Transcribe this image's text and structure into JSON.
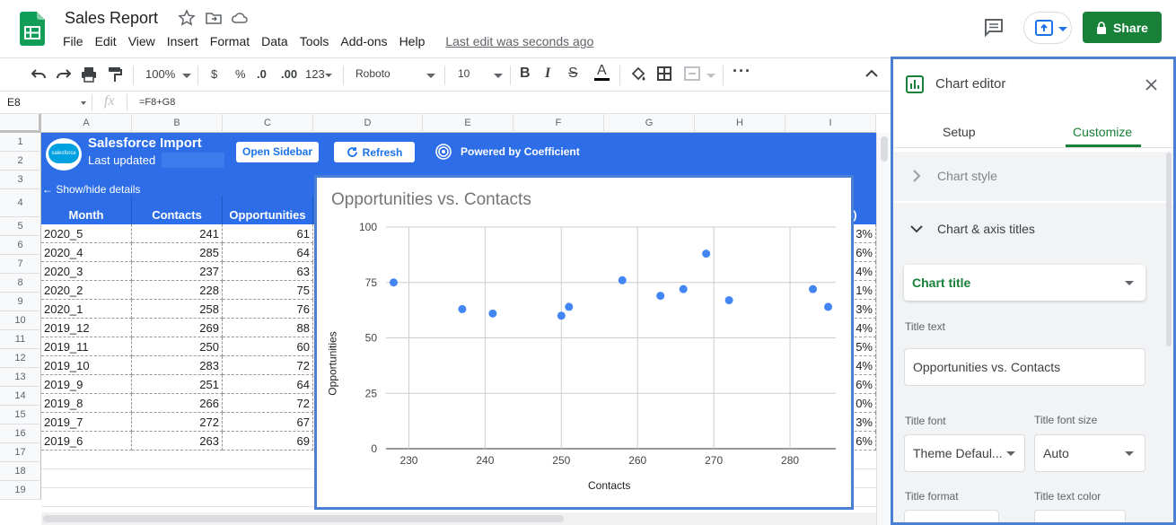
{
  "doc": {
    "title": "Sales Report",
    "menu": [
      "File",
      "Edit",
      "View",
      "Insert",
      "Format",
      "Data",
      "Tools",
      "Add-ons",
      "Help"
    ],
    "last_edit": "Last edit was seconds ago",
    "share_label": "Share"
  },
  "toolbar": {
    "zoom": "100%",
    "currency": "$",
    "percent": "%",
    "dec_less": ".0",
    "dec_more": ".00",
    "format_more": "123",
    "font": "Roboto",
    "font_size": "10"
  },
  "formula": {
    "cell_ref": "E8",
    "fx": "fx",
    "formula": "=F8+G8"
  },
  "columns": [
    "A",
    "B",
    "C",
    "D",
    "E",
    "F",
    "G",
    "H",
    "I"
  ],
  "rows": [
    "1",
    "2",
    "3",
    "4",
    "5",
    "6",
    "7",
    "8",
    "9",
    "10",
    "11",
    "12",
    "13",
    "14",
    "15",
    "16",
    "17",
    "18",
    "19"
  ],
  "banner": {
    "title": "Salesforce Import",
    "subtitle": "Last updated",
    "open_sidebar": "Open Sidebar",
    "refresh": "Refresh",
    "powered_by": "Powered by Coefficient",
    "show_hide": "← Show/hide details",
    "logo_text": "salesforce"
  },
  "table": {
    "headers": [
      "Month",
      "Contacts",
      "Opportunities"
    ],
    "right_header_fragment": "6)",
    "rows": [
      {
        "month": "2020_5",
        "contacts": "241",
        "opps": "61",
        "pct": "3%"
      },
      {
        "month": "2020_4",
        "contacts": "285",
        "opps": "64",
        "pct": "6%"
      },
      {
        "month": "2020_3",
        "contacts": "237",
        "opps": "63",
        "pct": "4%"
      },
      {
        "month": "2020_2",
        "contacts": "228",
        "opps": "75",
        "pct": "1%"
      },
      {
        "month": "2020_1",
        "contacts": "258",
        "opps": "76",
        "pct": "3%"
      },
      {
        "month": "2019_12",
        "contacts": "269",
        "opps": "88",
        "pct": "4%"
      },
      {
        "month": "2019_11",
        "contacts": "250",
        "opps": "60",
        "pct": "5%"
      },
      {
        "month": "2019_10",
        "contacts": "283",
        "opps": "72",
        "pct": "4%"
      },
      {
        "month": "2019_9",
        "contacts": "251",
        "opps": "64",
        "pct": "6%"
      },
      {
        "month": "2019_8",
        "contacts": "266",
        "opps": "72",
        "pct": "0%"
      },
      {
        "month": "2019_7",
        "contacts": "272",
        "opps": "67",
        "pct": "3%"
      },
      {
        "month": "2019_6",
        "contacts": "263",
        "opps": "69",
        "pct": "6%"
      }
    ]
  },
  "chart_data": {
    "type": "scatter",
    "title": "Opportunities vs. Contacts",
    "xlabel": "Contacts",
    "ylabel": "Opportunities",
    "xlim": [
      227,
      286
    ],
    "ylim": [
      0,
      100
    ],
    "xticks": [
      "230",
      "240",
      "250",
      "260",
      "270",
      "280"
    ],
    "yticks": [
      "0",
      "25",
      "50",
      "75",
      "100"
    ],
    "grid": true,
    "series": [
      {
        "x": [
          228,
          237,
          241,
          250,
          251,
          258,
          263,
          266,
          269,
          272,
          283,
          285
        ],
        "y": [
          75,
          63,
          61,
          60,
          64,
          76,
          69,
          72,
          88,
          67,
          72,
          64
        ]
      }
    ],
    "colors": {
      "point": "#4285f4"
    }
  },
  "editor": {
    "title": "Chart editor",
    "tab_setup": "Setup",
    "tab_customize": "Customize",
    "section_style": "Chart style",
    "section_titles": "Chart & axis titles",
    "title_select": "Chart title",
    "title_text_label": "Title text",
    "title_text_value": "Opportunities vs. Contacts",
    "title_font_label": "Title font",
    "title_font_value": "Theme Defaul...",
    "title_size_label": "Title font size",
    "title_size_value": "Auto",
    "title_format_label": "Title format",
    "title_color_label": "Title text color"
  },
  "colors": {
    "accent_green": "#188038",
    "banner_blue": "#2d6ee8",
    "highlight_border": "#4a7fd3"
  }
}
